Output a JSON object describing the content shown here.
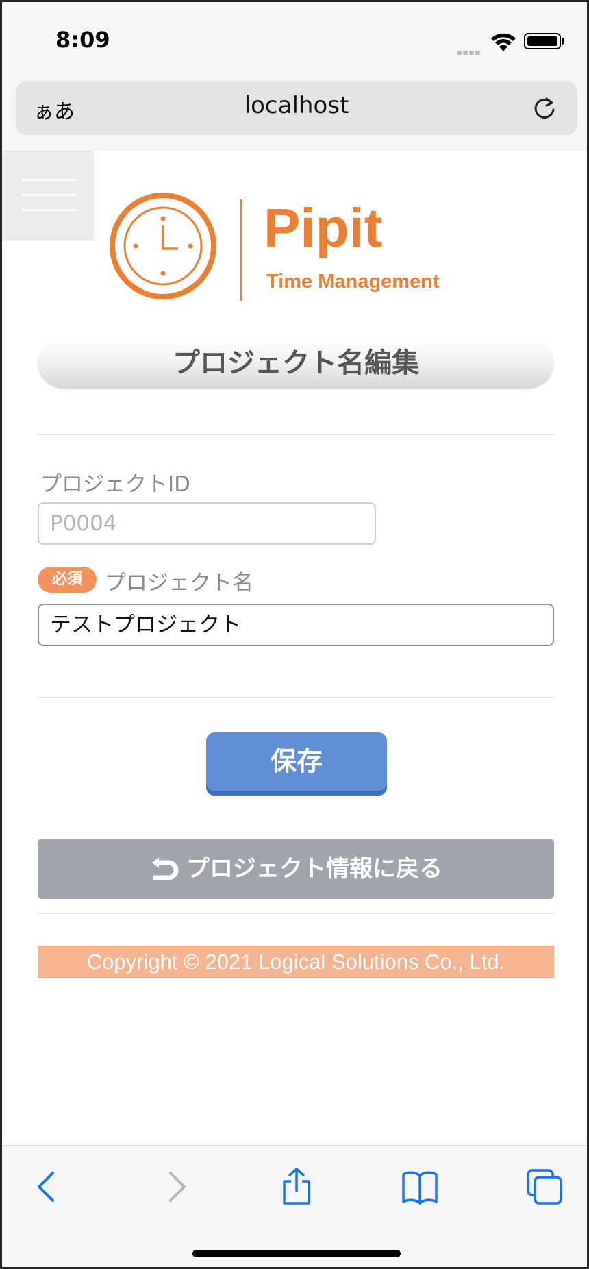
{
  "status_bar": {
    "time": "8:09"
  },
  "browser": {
    "aa_label": "ぁあ",
    "url": "localhost"
  },
  "logo": {
    "name": "Pipit",
    "subtitle": "Time Management"
  },
  "page": {
    "title": "プロジェクト名編集",
    "project_id": {
      "label": "プロジェクトID",
      "placeholder": "P0004"
    },
    "project_name": {
      "required_badge": "必須",
      "label": "プロジェクト名",
      "value": "テストプロジェクト"
    },
    "save_label": "保存",
    "back_label": "プロジェクト情報に戻る"
  },
  "footer": {
    "copyright": "Copyright © 2021 Logical Solutions Co., Ltd."
  },
  "colors": {
    "brand_orange": "#ee7f32",
    "save_blue": "#5f8fd5",
    "back_gray": "#9fa5ab",
    "footer_orange": "#f3b48f",
    "ios_blue": "#1a73e8"
  },
  "toolbar": {
    "icons": [
      "back-arrow-icon",
      "forward-arrow-icon",
      "share-icon",
      "bookmarks-icon",
      "tabs-icon"
    ]
  }
}
